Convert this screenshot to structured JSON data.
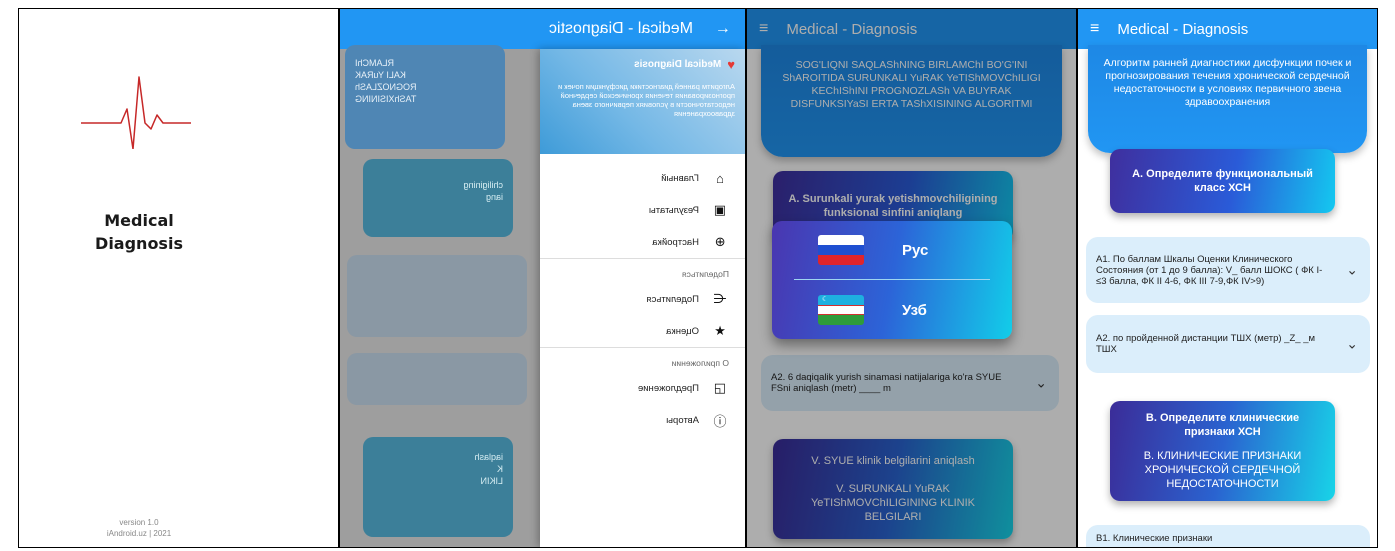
{
  "colors": {
    "primary": "#2196f3",
    "ecg": "#c62828"
  },
  "splash": {
    "title_line1": "Medical",
    "title_line2": "Diagnosis",
    "version": "version 1.0",
    "copyright": "iAndroid.uz | 2021"
  },
  "app": {
    "title": "Medical - Diagnosis"
  },
  "drawer_screen": {
    "appbar_title": "Medical - Diagnostic",
    "back_icon": "arrow-icon",
    "header_logo_text": "Medical Diagnosis",
    "header_description": "Алгоритм ранней диагностики дисфункции почек и прогнозирования течения хронической сердечной недостаточности в условиях первичного звена здравоохранения",
    "bg_card_text_1": "RLAMChI",
    "bg_card_text_2": "KALI YuRAK",
    "bg_card_text_3": "ROGNOZLASh",
    "bg_card_text_4": "TAShXISINING",
    "bg_card_text_5": "chiligining",
    "bg_card_text_6": "iang",
    "bg_card_text_7": "iaqlash",
    "bg_card_text_8": "K",
    "bg_card_text_9": "LIKIN",
    "items_main": [
      {
        "label": "Главный",
        "icon": "home-icon"
      },
      {
        "label": "Результаты",
        "icon": "clipboard-icon"
      },
      {
        "label": "Настройка",
        "icon": "globe-icon"
      }
    ],
    "section_share": "Поделиться",
    "items_share": [
      {
        "label": "Поделиться",
        "icon": "share-icon"
      },
      {
        "label": "Оценка",
        "icon": "star-icon"
      }
    ],
    "section_about": "О приложении",
    "items_about": [
      {
        "label": "Предложение",
        "icon": "feedback-icon"
      },
      {
        "label": "Авторы",
        "icon": "info-icon"
      }
    ]
  },
  "uz_screen": {
    "hero_text": "SOG'LIQNI SAQLAShNING BIRLAMChI BO'G'INI ShAROITIDA SURUNKALI YuRAK YeTIShMOVChILIGI KEChIShINI PROGNOZLASh VA BUYRAK DISFUNKSIYaSI ERTA TAShXISINING ALGORITMI",
    "card_a": "A. Surunkali yurak yetishmovchiligining funksional sinfini aniqlang",
    "acc_a2": "A2. 6 daqiqalik yurish sinamasi natijalariga ko'ra SYUE FSni aniqlash (metr) ____ m",
    "card_v_line1": "V. SYUE klinik belgilarini aniqlash",
    "card_v_line2": "V. SURUNKALI YuRAK YeTIShMOVChILIGINING KLINIK BELGILARI",
    "lang_ru": "Рус",
    "lang_uz": "Узб"
  },
  "ru_screen": {
    "hero_text": "Алгоритм ранней диагностики дисфункции почек и прогнозирования течения хронической сердечной недостаточности  в условиях первичного звена здравоохранения",
    "card_a": "А. Определите функциональный класс ХСН",
    "acc_a1": "А1. По баллам Шкалы Оценки Клинического Состояния (от 1 до 9 балла):  V_ балл ШОКС  ( ФК I-≤3 балла, ФК II 4-6, ФК III 7-9,ФК IV>9)",
    "acc_a2": "А2. по пройденной дистанции ТШХ (метр)  _Z_ _м ТШХ",
    "card_b_line1": "В. Определите клинические признаки ХСН",
    "card_b_line2": "В. КЛИНИЧЕСКИЕ ПРИЗНАКИ ХРОНИЧЕСКОЙ СЕРДЕЧНОЙ НЕДОСТАТОЧНОСТИ",
    "acc_b1": "В1. Клинические признаки"
  }
}
